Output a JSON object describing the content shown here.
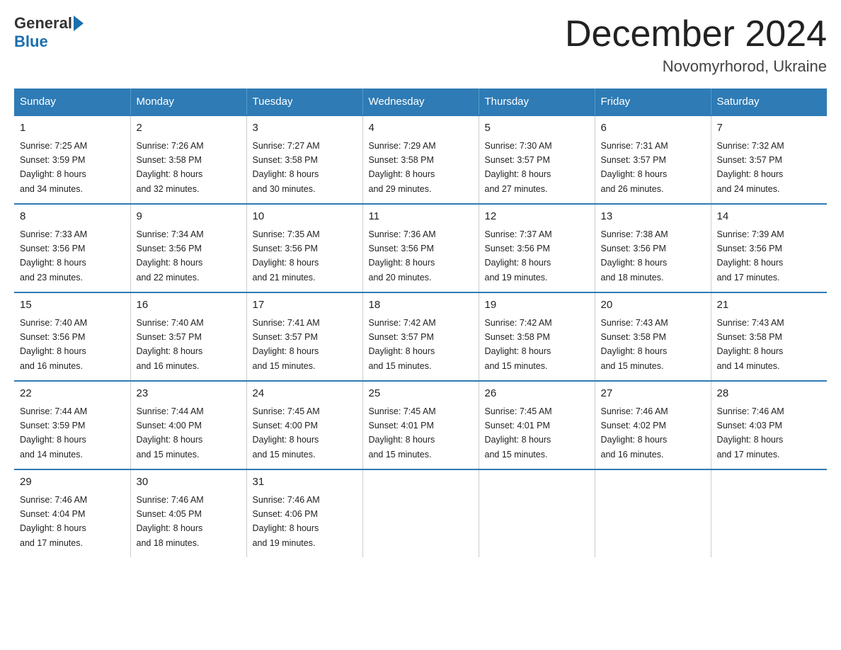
{
  "header": {
    "logo_general": "General",
    "logo_blue": "Blue",
    "month_title": "December 2024",
    "location": "Novomyrhorod, Ukraine"
  },
  "days_of_week": [
    "Sunday",
    "Monday",
    "Tuesday",
    "Wednesday",
    "Thursday",
    "Friday",
    "Saturday"
  ],
  "weeks": [
    [
      {
        "num": "1",
        "sunrise": "7:25 AM",
        "sunset": "3:59 PM",
        "daylight": "8 hours and 34 minutes."
      },
      {
        "num": "2",
        "sunrise": "7:26 AM",
        "sunset": "3:58 PM",
        "daylight": "8 hours and 32 minutes."
      },
      {
        "num": "3",
        "sunrise": "7:27 AM",
        "sunset": "3:58 PM",
        "daylight": "8 hours and 30 minutes."
      },
      {
        "num": "4",
        "sunrise": "7:29 AM",
        "sunset": "3:58 PM",
        "daylight": "8 hours and 29 minutes."
      },
      {
        "num": "5",
        "sunrise": "7:30 AM",
        "sunset": "3:57 PM",
        "daylight": "8 hours and 27 minutes."
      },
      {
        "num": "6",
        "sunrise": "7:31 AM",
        "sunset": "3:57 PM",
        "daylight": "8 hours and 26 minutes."
      },
      {
        "num": "7",
        "sunrise": "7:32 AM",
        "sunset": "3:57 PM",
        "daylight": "8 hours and 24 minutes."
      }
    ],
    [
      {
        "num": "8",
        "sunrise": "7:33 AM",
        "sunset": "3:56 PM",
        "daylight": "8 hours and 23 minutes."
      },
      {
        "num": "9",
        "sunrise": "7:34 AM",
        "sunset": "3:56 PM",
        "daylight": "8 hours and 22 minutes."
      },
      {
        "num": "10",
        "sunrise": "7:35 AM",
        "sunset": "3:56 PM",
        "daylight": "8 hours and 21 minutes."
      },
      {
        "num": "11",
        "sunrise": "7:36 AM",
        "sunset": "3:56 PM",
        "daylight": "8 hours and 20 minutes."
      },
      {
        "num": "12",
        "sunrise": "7:37 AM",
        "sunset": "3:56 PM",
        "daylight": "8 hours and 19 minutes."
      },
      {
        "num": "13",
        "sunrise": "7:38 AM",
        "sunset": "3:56 PM",
        "daylight": "8 hours and 18 minutes."
      },
      {
        "num": "14",
        "sunrise": "7:39 AM",
        "sunset": "3:56 PM",
        "daylight": "8 hours and 17 minutes."
      }
    ],
    [
      {
        "num": "15",
        "sunrise": "7:40 AM",
        "sunset": "3:56 PM",
        "daylight": "8 hours and 16 minutes."
      },
      {
        "num": "16",
        "sunrise": "7:40 AM",
        "sunset": "3:57 PM",
        "daylight": "8 hours and 16 minutes."
      },
      {
        "num": "17",
        "sunrise": "7:41 AM",
        "sunset": "3:57 PM",
        "daylight": "8 hours and 15 minutes."
      },
      {
        "num": "18",
        "sunrise": "7:42 AM",
        "sunset": "3:57 PM",
        "daylight": "8 hours and 15 minutes."
      },
      {
        "num": "19",
        "sunrise": "7:42 AM",
        "sunset": "3:58 PM",
        "daylight": "8 hours and 15 minutes."
      },
      {
        "num": "20",
        "sunrise": "7:43 AM",
        "sunset": "3:58 PM",
        "daylight": "8 hours and 15 minutes."
      },
      {
        "num": "21",
        "sunrise": "7:43 AM",
        "sunset": "3:58 PM",
        "daylight": "8 hours and 14 minutes."
      }
    ],
    [
      {
        "num": "22",
        "sunrise": "7:44 AM",
        "sunset": "3:59 PM",
        "daylight": "8 hours and 14 minutes."
      },
      {
        "num": "23",
        "sunrise": "7:44 AM",
        "sunset": "4:00 PM",
        "daylight": "8 hours and 15 minutes."
      },
      {
        "num": "24",
        "sunrise": "7:45 AM",
        "sunset": "4:00 PM",
        "daylight": "8 hours and 15 minutes."
      },
      {
        "num": "25",
        "sunrise": "7:45 AM",
        "sunset": "4:01 PM",
        "daylight": "8 hours and 15 minutes."
      },
      {
        "num": "26",
        "sunrise": "7:45 AM",
        "sunset": "4:01 PM",
        "daylight": "8 hours and 15 minutes."
      },
      {
        "num": "27",
        "sunrise": "7:46 AM",
        "sunset": "4:02 PM",
        "daylight": "8 hours and 16 minutes."
      },
      {
        "num": "28",
        "sunrise": "7:46 AM",
        "sunset": "4:03 PM",
        "daylight": "8 hours and 17 minutes."
      }
    ],
    [
      {
        "num": "29",
        "sunrise": "7:46 AM",
        "sunset": "4:04 PM",
        "daylight": "8 hours and 17 minutes."
      },
      {
        "num": "30",
        "sunrise": "7:46 AM",
        "sunset": "4:05 PM",
        "daylight": "8 hours and 18 minutes."
      },
      {
        "num": "31",
        "sunrise": "7:46 AM",
        "sunset": "4:06 PM",
        "daylight": "8 hours and 19 minutes."
      },
      null,
      null,
      null,
      null
    ]
  ],
  "labels": {
    "sunrise": "Sunrise:",
    "sunset": "Sunset:",
    "daylight": "Daylight:"
  }
}
